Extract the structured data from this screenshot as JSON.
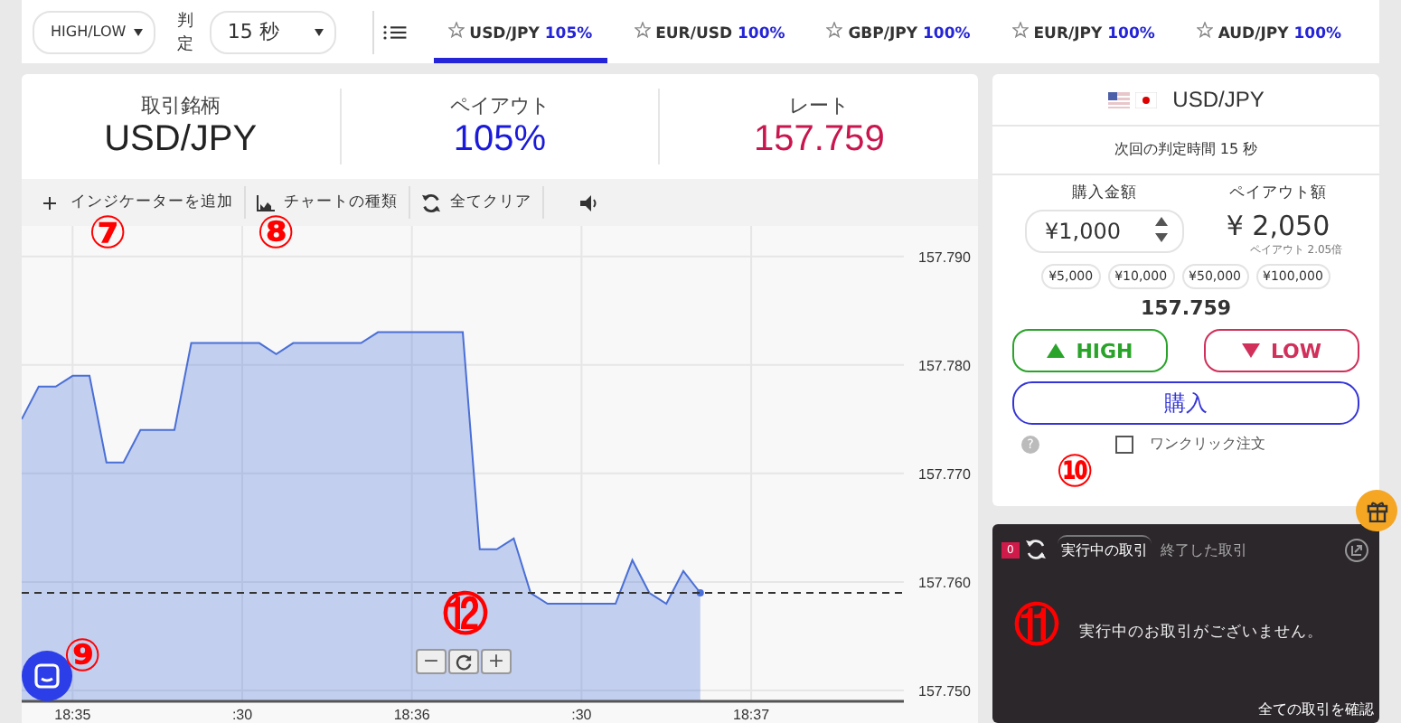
{
  "top_bar": {
    "mode_select": {
      "value": "HIGH/LOW"
    },
    "expiry_label": "判定",
    "expiry_select": {
      "value": "15 秒"
    },
    "tabs": [
      {
        "pair": "USD/JPY",
        "payout": "105%",
        "selected": true
      },
      {
        "pair": "EUR/USD",
        "payout": "100%",
        "selected": false
      },
      {
        "pair": "GBP/JPY",
        "payout": "100%",
        "selected": false
      },
      {
        "pair": "EUR/JPY",
        "payout": "100%",
        "selected": false
      },
      {
        "pair": "AUD/JPY",
        "payout": "100%",
        "selected": false
      }
    ]
  },
  "summary": [
    {
      "label": "取引銘柄",
      "value": "USD/JPY",
      "kind": "plain"
    },
    {
      "label": "ペイアウト",
      "value": "105%",
      "kind": "payout"
    },
    {
      "label": "レート",
      "value": "157.759",
      "kind": "rate"
    }
  ],
  "toolbar": [
    {
      "label": "インジケーターを追加",
      "kind": "add"
    },
    {
      "label": "チャートの種類",
      "kind": "chart"
    },
    {
      "label": "全てクリア",
      "kind": "clear"
    },
    {
      "kind": "sound"
    }
  ],
  "chart": {
    "zoom_buttons": [
      {
        "label": "−",
        "kind": "text"
      },
      {
        "kind": "reset"
      },
      {
        "label": "+",
        "kind": "text"
      }
    ],
    "chart_data": {
      "type": "area",
      "categories": [
        null,
        null,
        null,
        "18:35",
        null,
        null,
        null,
        null,
        null,
        null,
        null,
        null,
        null,
        ":30",
        null,
        null,
        null,
        null,
        null,
        null,
        null,
        null,
        null,
        "18:36",
        null,
        null,
        null,
        null,
        null,
        null,
        null,
        null,
        null,
        ":30",
        null,
        null,
        null,
        null,
        null,
        null,
        null,
        null,
        null,
        "18:37",
        null,
        null,
        null,
        null,
        null,
        null,
        null,
        null
      ],
      "series": [
        {
          "color": "#4a6fd6",
          "values": [
            157.775,
            157.778,
            157.778,
            157.779,
            157.779,
            157.771,
            157.771,
            157.774,
            157.774,
            157.774,
            157.782,
            157.782,
            157.782,
            157.782,
            157.782,
            157.781,
            157.782,
            157.782,
            157.782,
            157.782,
            157.782,
            157.783,
            157.783,
            157.783,
            157.783,
            157.783,
            157.783,
            157.763,
            157.763,
            157.764,
            157.759,
            157.758,
            157.758,
            157.758,
            157.758,
            157.758,
            157.762,
            157.759,
            157.758,
            157.761,
            157.759,
            null,
            null,
            null,
            null,
            null,
            null,
            null,
            null,
            null,
            null,
            null
          ]
        }
      ],
      "ylim": [
        157.749,
        157.7928
      ],
      "grid": true,
      "yticks": [
        {
          "value": 157.79,
          "label": "157.790"
        },
        {
          "value": 157.78,
          "label": "157.780"
        },
        {
          "value": 157.77,
          "label": "157.770"
        },
        {
          "value": 157.76,
          "label": "157.760"
        },
        {
          "value": 157.75,
          "label": "157.750"
        }
      ]
    }
  },
  "order_panel": {
    "pair": "USD/JPY",
    "next_expiry": "次回の判定時間 15 秒",
    "amount_label": "購入金額",
    "payout_label": "ペイアウト額",
    "amount": "¥1,000",
    "payout_amount": "¥ 2,050",
    "payout_ratio": "ペイアウト 2.05倍",
    "presets": [
      "¥5,000",
      "¥10,000",
      "¥50,000",
      "¥100,000"
    ],
    "rate": "157.759",
    "high_button": "HIGH",
    "low_button": "LOW",
    "buy_button": "購入",
    "help": "?",
    "one_click": {
      "label": "ワンクリック注文",
      "checked": false
    }
  },
  "trades_panel": {
    "badge": "0",
    "tabs": [
      {
        "label": "実行中の取引",
        "selected": true
      },
      {
        "label": "終了した取引",
        "selected": false
      }
    ],
    "message": "実行中のお取引がございません。",
    "link": "全ての取引を確認"
  },
  "callouts": [
    {
      "text": "⑦",
      "kind": "indicator"
    },
    {
      "text": "⑧",
      "kind": "chart-type"
    },
    {
      "text": "⑩",
      "kind": "one-click"
    },
    {
      "text": "⑫",
      "kind": "zoom"
    },
    {
      "text": "⑪",
      "kind": "trades"
    },
    {
      "text": "⑨",
      "kind": "chat"
    }
  ]
}
